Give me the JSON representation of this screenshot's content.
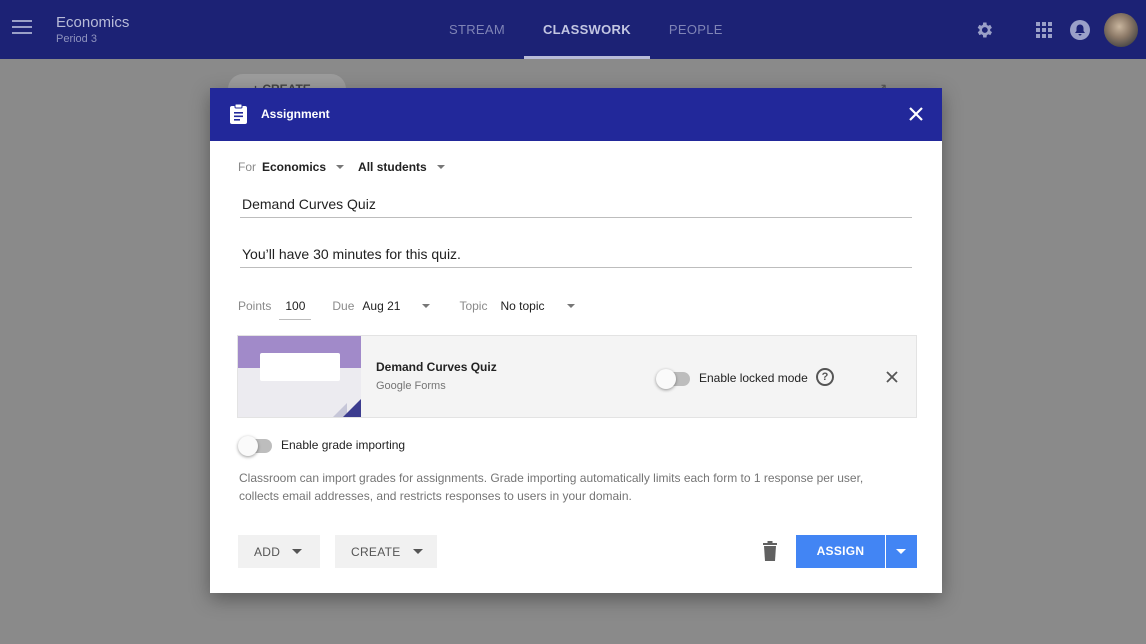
{
  "app": {
    "class_name": "Economics",
    "class_period": "Period 3",
    "tabs": [
      {
        "label": "STREAM"
      },
      {
        "label": "CLASSWORK"
      },
      {
        "label": "PEOPLE"
      }
    ],
    "active_tab": "CLASSWORK"
  },
  "background": {
    "create_label": "+ CREATE"
  },
  "dialog": {
    "title": "Assignment",
    "for_label": "For",
    "class_select": "Economics",
    "students_select": "All students",
    "title_value": "Demand Curves Quiz",
    "instructions_value": "You’ll have 30 minutes for this quiz.",
    "points_label": "Points",
    "points_value": "100",
    "due_label": "Due",
    "due_value": "Aug 21",
    "topic_label": "Topic",
    "topic_value": "No topic",
    "attachment": {
      "title": "Demand Curves Quiz",
      "type": "Google Forms",
      "locked_mode_label": "Enable locked mode",
      "locked_mode_enabled": false
    },
    "grade_importing_label": "Enable grade importing",
    "grade_importing_enabled": false,
    "grade_importing_info": "Classroom can import grades for assignments. Grade importing automatically limits each form to 1 response per user, collects email addresses, and restricts responses to users in your domain.",
    "add_label": "ADD",
    "create_label": "CREATE",
    "assign_label": "ASSIGN"
  },
  "colors": {
    "header": "#1c2275",
    "dialog_header": "#22289a",
    "assign_button": "#4285f4",
    "overlay": "#8a8a8a"
  }
}
